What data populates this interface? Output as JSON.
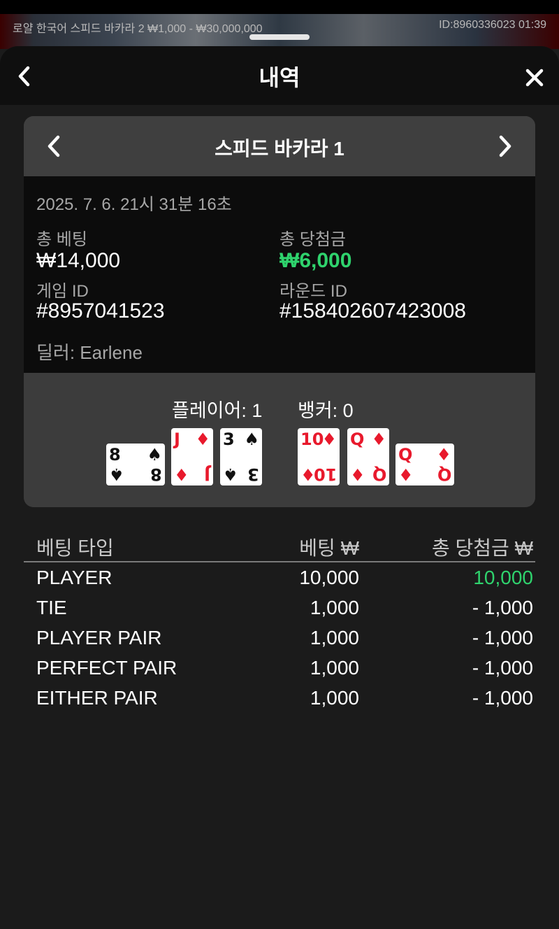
{
  "topbar": {
    "game_info": "로얄 한국어 스피드 바카라 2  ₩1,000 - ₩30,000,000",
    "session_info": "ID:8960336023  01:39"
  },
  "header": {
    "title": "내역"
  },
  "game_card": {
    "title": "스피드 바카라 1",
    "datetime": "2025. 7. 6. 21시 31분 16초",
    "total_bet_label": "총 베팅",
    "total_bet_value": "₩14,000",
    "total_win_label": "총 당첨금",
    "total_win_value": "₩6,000",
    "game_id_label": "게임 ID",
    "game_id_value": "#8957041523",
    "round_id_label": "라운드 ID",
    "round_id_value": "#158402607423008",
    "dealer": "딜러: Earlene"
  },
  "result": {
    "player_label": "플레이어: 1",
    "banker_label": "뱅커: 0",
    "player_cards": [
      {
        "rank": "8",
        "suit": "♠",
        "color": "#111111",
        "orientation": "sideways"
      },
      {
        "rank": "J",
        "suit": "♦",
        "color": "#e8192c",
        "orientation": "upright"
      },
      {
        "rank": "3",
        "suit": "♠",
        "color": "#111111",
        "orientation": "upright"
      }
    ],
    "banker_cards": [
      {
        "rank": "10",
        "suit": "♦",
        "color": "#e8192c",
        "orientation": "upright"
      },
      {
        "rank": "Q",
        "suit": "♦",
        "color": "#e8192c",
        "orientation": "upright"
      },
      {
        "rank": "Q",
        "suit": "♦",
        "color": "#e8192c",
        "orientation": "sideways"
      }
    ]
  },
  "bets": {
    "headers": {
      "type": "베팅 타입",
      "bet": "베팅 ₩",
      "win": "총 당첨금 ₩"
    },
    "rows": [
      {
        "type": "PLAYER",
        "bet": "10,000",
        "win": "10,000"
      },
      {
        "type": "TIE",
        "bet": "1,000",
        "win": "- 1,000"
      },
      {
        "type": "PLAYER PAIR",
        "bet": "1,000",
        "win": "- 1,000"
      },
      {
        "type": "PERFECT PAIR",
        "bet": "1,000",
        "win": "- 1,000"
      },
      {
        "type": "EITHER PAIR",
        "bet": "1,000",
        "win": "- 1,000"
      }
    ]
  },
  "colors": {
    "win_green": "#2fd36d",
    "card_red": "#e8192c"
  },
  "icons": {
    "back": "chevron-left-icon",
    "close": "close-icon",
    "prev": "chevron-left-icon",
    "next": "chevron-right-icon"
  }
}
